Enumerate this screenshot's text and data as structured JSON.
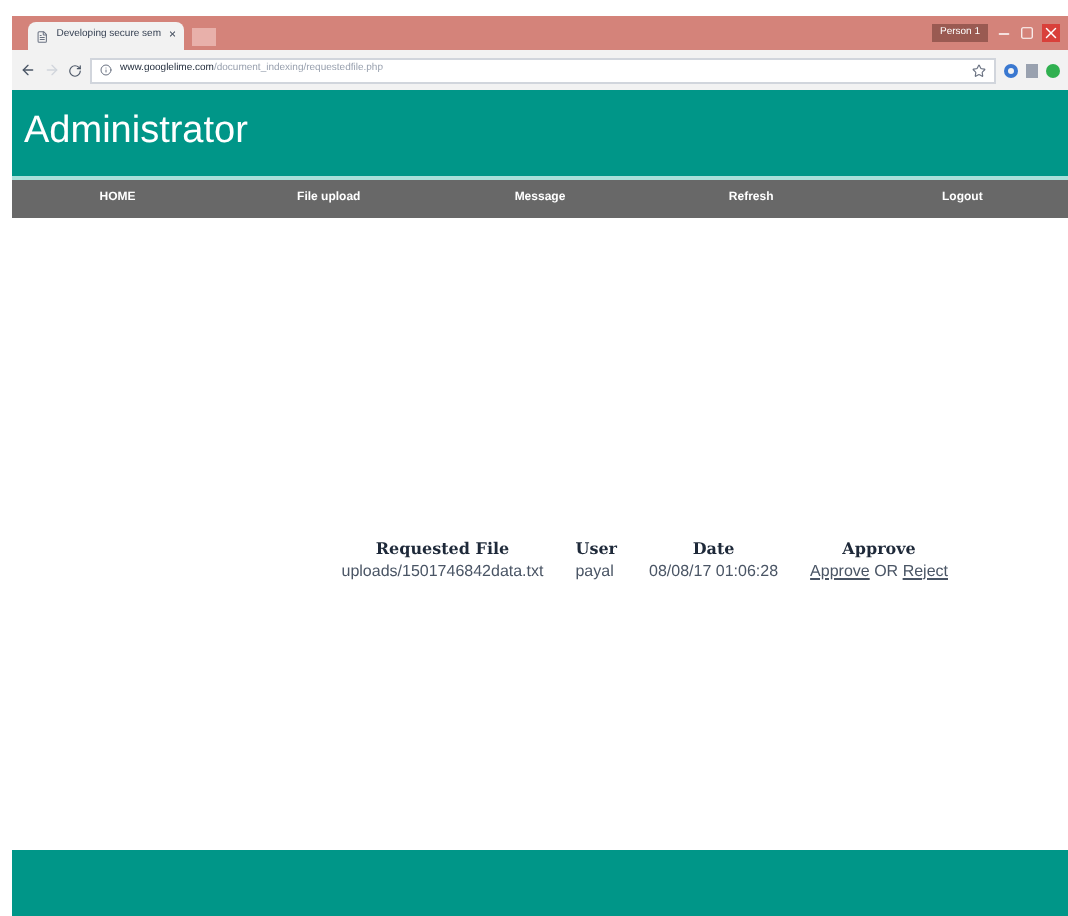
{
  "browser": {
    "tab_title": "Developing secure sem",
    "tab_close": "×",
    "profile": "Person 1",
    "url_host": "www.googlelime.com",
    "url_path": "/document_indexing/requestedfile.php"
  },
  "header": {
    "title": "Administrator"
  },
  "nav": [
    "HOME",
    "File upload",
    "Message",
    "Refresh",
    "Logout"
  ],
  "table": {
    "columns": [
      "Requested File",
      "User",
      "Date",
      "Approve"
    ],
    "rows": [
      {
        "file": "uploads/1501746842data.txt",
        "user": "payal",
        "date": "08/08/17 01:06:28",
        "approve": "Approve",
        "or": "OR",
        "reject": "Reject"
      }
    ]
  }
}
